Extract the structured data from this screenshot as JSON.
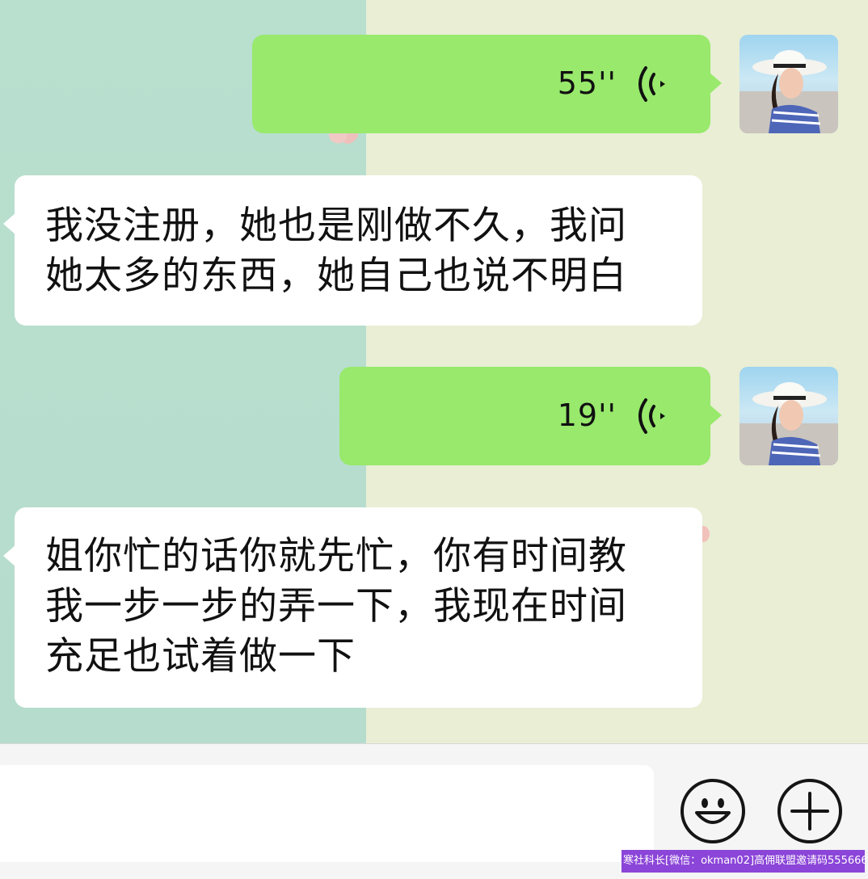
{
  "messages": [
    {
      "sender": "me",
      "type": "voice",
      "duration": "55''",
      "icon": "voice-wave-icon"
    },
    {
      "sender": "them",
      "type": "text",
      "lines": [
        "我没注册，她也是刚做不久，我问",
        "她太多的东西，她自己也说不明白"
      ]
    },
    {
      "sender": "me",
      "type": "voice",
      "duration": "19''",
      "icon": "voice-wave-icon"
    },
    {
      "sender": "them",
      "type": "text",
      "lines": [
        "姐你忙的话你就先忙，你有时间教",
        "我一步一步的弄一下，我现在时间",
        "充足也试着做一下"
      ]
    }
  ],
  "input_bar": {
    "emoji_icon": "smiley-icon",
    "plus_icon": "plus-icon"
  },
  "watermark": {
    "text": "寒社科长[微信：okman02]高佣联盟邀请码555666"
  },
  "colors": {
    "my_bubble": "#98e96c",
    "their_bubble": "#ffffff",
    "bg_left": "#b9dfcf",
    "bg_right": "#e9eed5",
    "watermark_bg": "#8b45d8"
  }
}
